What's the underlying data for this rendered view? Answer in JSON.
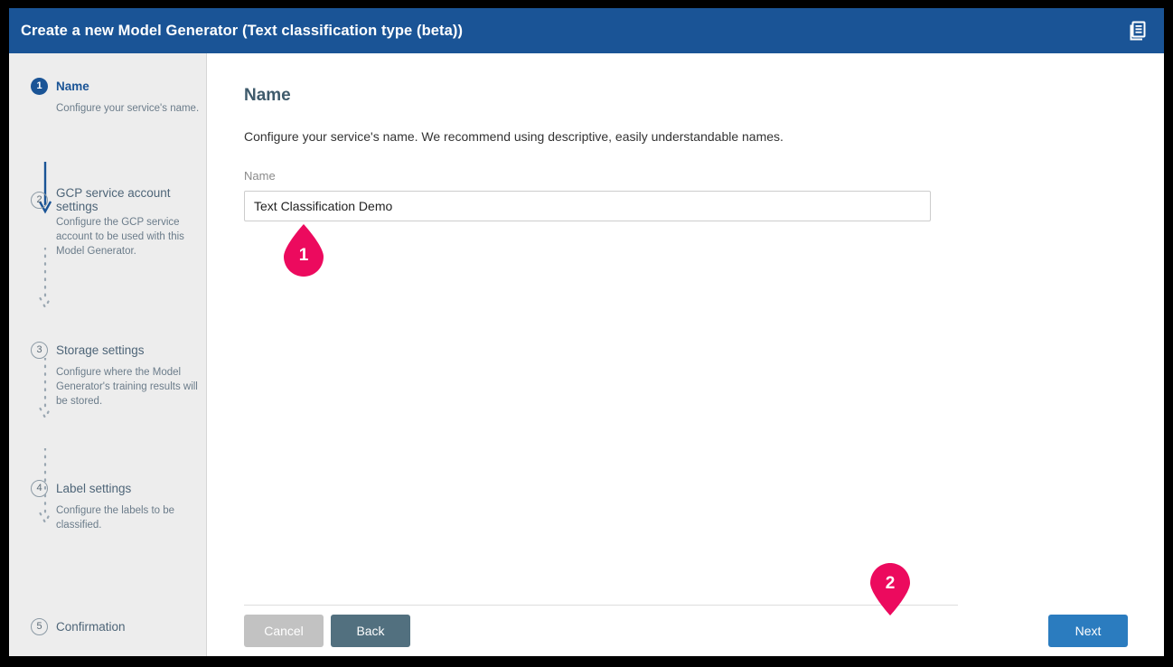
{
  "header": {
    "title": "Create a new Model Generator (Text classification type (beta))",
    "icon": "copy-documents-icon",
    "background_color": "#1a5496"
  },
  "sidebar": {
    "steps": [
      {
        "number": "1",
        "label": "Name",
        "description": "Configure your service's name.",
        "state": "active",
        "connector": "solid-arrow"
      },
      {
        "number": "2",
        "label": "GCP service account settings",
        "description": "Configure the GCP service account to be used with this Model Generator.",
        "state": "inactive",
        "connector": "dotted-arrow"
      },
      {
        "number": "3",
        "label": "Storage settings",
        "description": "Configure where the Model Generator's training results will be stored.",
        "state": "inactive",
        "connector": "dotted-arrow"
      },
      {
        "number": "4",
        "label": "Label settings",
        "description": "Configure the labels to be classified.",
        "state": "inactive",
        "connector": "dotted-arrow"
      },
      {
        "number": "5",
        "label": "Confirmation",
        "description": "",
        "state": "inactive",
        "connector": "none"
      }
    ]
  },
  "main": {
    "title": "Name",
    "description": "Configure your service's name. We recommend using descriptive, easily understandable names.",
    "name_field": {
      "label": "Name",
      "value": "Text Classification Demo",
      "placeholder": ""
    }
  },
  "footer": {
    "cancel_label": "Cancel",
    "back_label": "Back",
    "next_label": "Next",
    "cancel_color": "#c2c2c2",
    "back_color": "#52707f",
    "next_color": "#2b7cbf"
  },
  "annotations": {
    "color": "#ec0a5e",
    "markers": [
      {
        "number": "1",
        "target": "name-input",
        "direction": "up"
      },
      {
        "number": "2",
        "target": "next-button",
        "direction": "down"
      }
    ]
  }
}
